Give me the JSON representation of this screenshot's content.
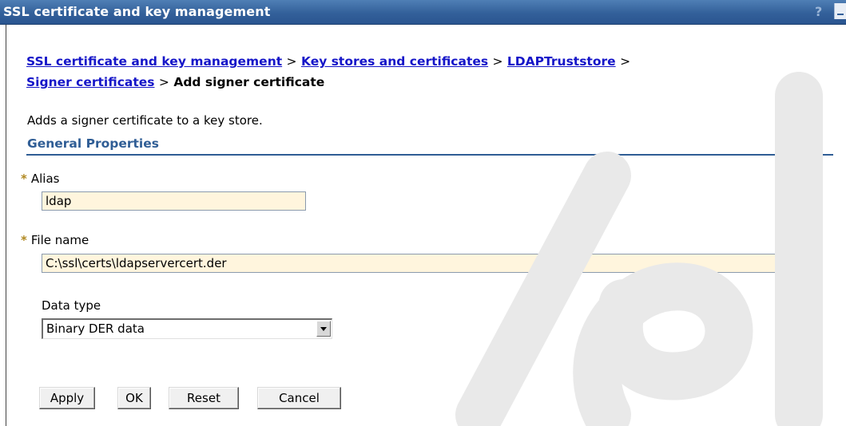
{
  "window": {
    "title": "SSL certificate and key management",
    "help_label": "?"
  },
  "breadcrumb": {
    "items": [
      {
        "label": "SSL certificate and key management",
        "link": true
      },
      {
        "label": "Key stores and certificates",
        "link": true
      },
      {
        "label": "LDAPTruststore",
        "link": true
      },
      {
        "label": "Signer certificates",
        "link": true
      },
      {
        "label": "Add signer certificate",
        "link": false
      }
    ],
    "separator": ">"
  },
  "page": {
    "description": "Adds a signer certificate to a key store.",
    "section_title": "General Properties"
  },
  "form": {
    "required_marker": "*",
    "alias": {
      "label": "Alias",
      "value": "ldap"
    },
    "file_name": {
      "label": "File name",
      "value": "C:\\ssl\\certs\\ldapservercert.der"
    },
    "data_type": {
      "label": "Data type",
      "selected": "Binary DER data"
    }
  },
  "buttons": {
    "apply": "Apply",
    "ok": "OK",
    "reset": "Reset",
    "cancel": "Cancel"
  },
  "colors": {
    "title_bar": "#33609a",
    "link": "#1515c8",
    "section": "#2f5d95",
    "field_bg": "#fff5dd"
  }
}
